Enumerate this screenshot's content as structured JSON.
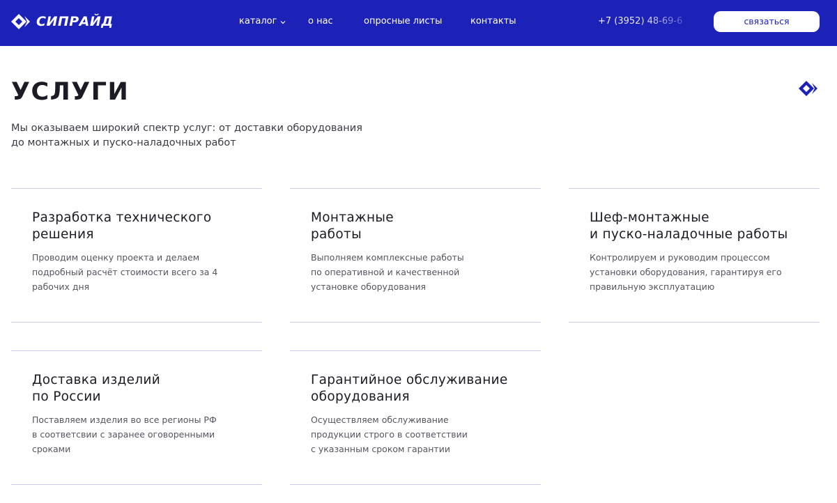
{
  "header": {
    "logo_text": "СИПРАЙД",
    "nav": {
      "catalog": "каталог",
      "about": "о нас",
      "forms": "опросные листы",
      "contacts": "контакты"
    },
    "phone": "+7 (3952) 48-69-6",
    "contact_button": "связаться",
    "colors": {
      "header_bg": "#1c21b8"
    }
  },
  "main": {
    "title": "УСЛУГИ",
    "description_line1": "Мы оказываем широкий спектр услуг: от доставки оборудования",
    "description_line2": "до монтажных и пуско-наладочных работ"
  },
  "services": [
    {
      "title_line1": "Разработка технического",
      "title_line2": "решения",
      "text_line1": "Проводим оценку проекта и делаем",
      "text_line2": "подробный расчёт стоимости всего за 4",
      "text_line3": "рабочих дня"
    },
    {
      "title_line1": "Монтажные",
      "title_line2": "работы",
      "text_line1": "Выполняем комплексные работы",
      "text_line2": "по оперативной и качественной",
      "text_line3": "установке оборудования"
    },
    {
      "title_line1": "Шеф-монтажные",
      "title_line2": "и пуско-наладочные работы",
      "text_line1": "Контролируем и руководим процессом",
      "text_line2": "установки оборудования, гарантируя его",
      "text_line3": "правильную эксплуатацию"
    },
    {
      "title_line1": "Доставка изделий",
      "title_line2": "по России",
      "text_line1": "Поставляем изделия во все регионы РФ",
      "text_line2": "в соответсвии с заранее оговоренными",
      "text_line3": "сроками"
    },
    {
      "title_line1": "Гарантийное обслуживание",
      "title_line2": "оборудования",
      "text_line1": "Осуществляем обслуживание",
      "text_line2": "продукции строго в соответствии",
      "text_line3": "с указанным сроком гарантии"
    }
  ]
}
